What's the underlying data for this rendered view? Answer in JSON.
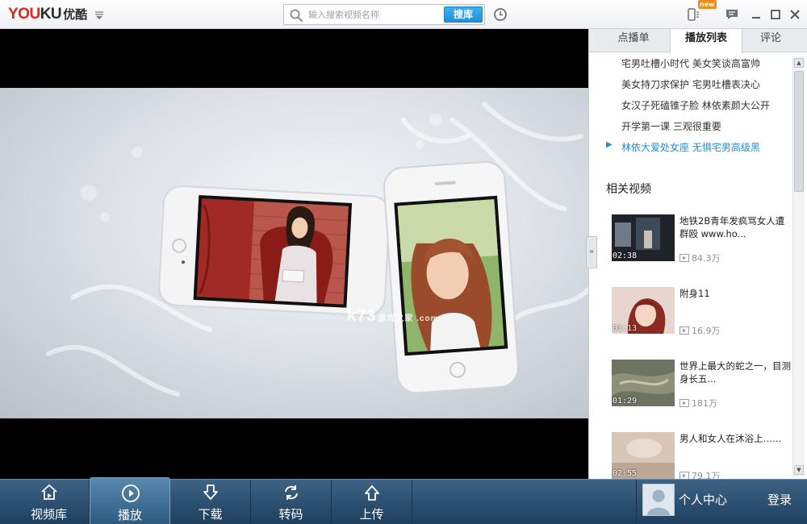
{
  "app": {
    "logo_latin_red": "YOU",
    "logo_latin_dark": "KU",
    "logo_chinese": "优酷"
  },
  "search": {
    "placeholder": "输入搜索视频名称",
    "button_label": "搜库"
  },
  "topbar": {
    "new_badge": "new"
  },
  "video": {
    "watermark_main": "k73",
    "watermark_small": "游戏之家 .com"
  },
  "sidebar": {
    "tabs": [
      {
        "label": "点播单"
      },
      {
        "label": "播放列表"
      },
      {
        "label": "评论"
      }
    ],
    "active_tab": "播放列表",
    "playlist": [
      {
        "title": "宅男吐槽小时代 美女笑谈高富帅",
        "active": false
      },
      {
        "title": "美女持刀求保护 宅男吐槽表决心",
        "active": false
      },
      {
        "title": "女汉子死磕锥子脸 林依素颜大公开",
        "active": false
      },
      {
        "title": "开学第一课 三观很重要",
        "active": false
      },
      {
        "title": "林依大爱处女座 无惧宅男高级黑",
        "active": true
      }
    ],
    "playing_indicator": "▶",
    "related_title": "相关视频",
    "related": [
      {
        "title": "地铁2B青年发疯骂女人遭群殴 www.ho...",
        "duration": "02:38",
        "views": "84.3万"
      },
      {
        "title": "附身11",
        "duration": "01:13",
        "views": "16.9万"
      },
      {
        "title": "世界上最大的蛇之一，目测身长五...",
        "duration": "01:29",
        "views": "181万"
      },
      {
        "title": "男人和女人在沐浴上……",
        "duration": "02:55",
        "views": "79.1万"
      }
    ],
    "collapse_label": "»",
    "scroll_up": "▲",
    "scroll_down": "▼"
  },
  "bottom_nav": {
    "items": [
      {
        "label": "视频库",
        "icon": "home-icon"
      },
      {
        "label": "播放",
        "icon": "play-circle-icon",
        "active": true
      },
      {
        "label": "下载",
        "icon": "download-arrow-icon"
      },
      {
        "label": "转码",
        "icon": "convert-icon"
      },
      {
        "label": "上传",
        "icon": "upload-arrow-icon"
      }
    ],
    "user_center": "个人中心",
    "login": "登录"
  },
  "colors": {
    "brand_red": "#e1261c",
    "accent_blue": "#1e8fd6",
    "nav_bg": "#2b4f70"
  }
}
